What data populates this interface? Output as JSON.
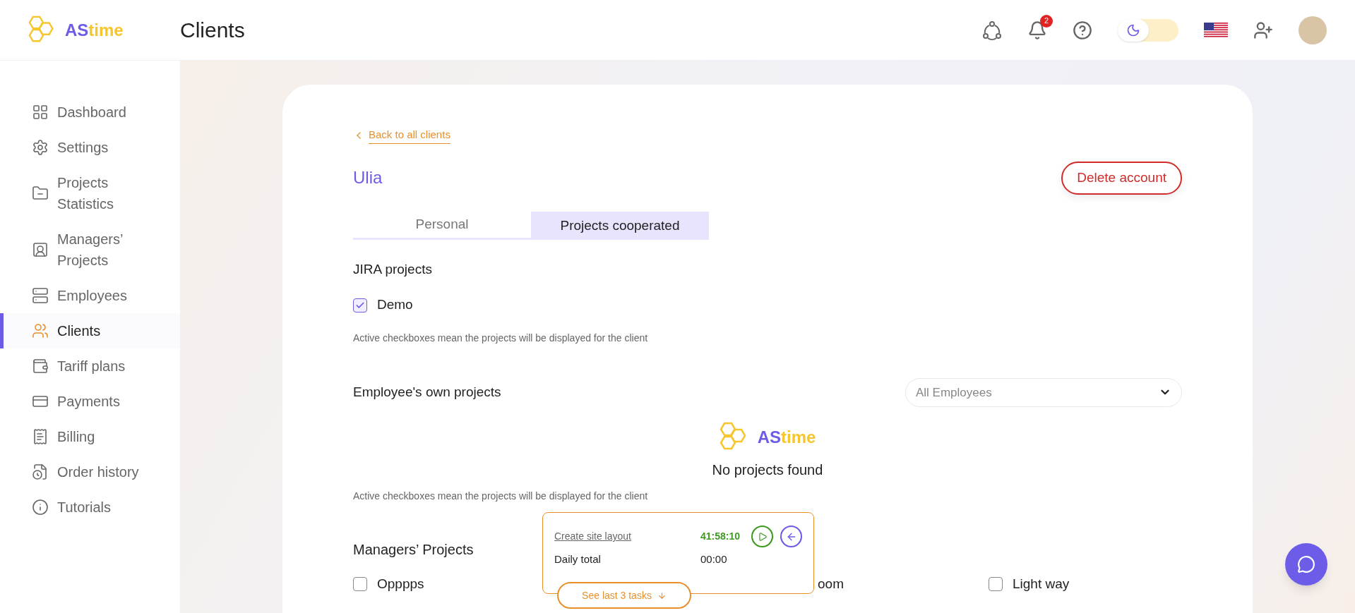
{
  "header": {
    "logo": {
      "prefix": "AS",
      "suffix": "time"
    },
    "title": "Clients",
    "notifications": "2",
    "dark_mode": false
  },
  "sidebar": {
    "items": [
      {
        "label": "Dashboard",
        "selected": false
      },
      {
        "label": "Settings",
        "selected": false
      },
      {
        "label": "Projects Statistics",
        "selected": false
      },
      {
        "label": "Managers’ Projects",
        "selected": false
      },
      {
        "label": "Employees",
        "selected": false
      },
      {
        "label": "Clients",
        "selected": true
      },
      {
        "label": "Tariff plans",
        "selected": false
      },
      {
        "label": "Payments",
        "selected": false
      },
      {
        "label": "Billing",
        "selected": false
      },
      {
        "label": "Order history",
        "selected": false
      },
      {
        "label": "Tutorials",
        "selected": false
      }
    ]
  },
  "client": {
    "back_link": "Back to all clients",
    "name": "Ulia",
    "delete_button": "Delete account",
    "tabs": [
      {
        "label": "Personal",
        "selected": false
      },
      {
        "label": "Projects cooperated",
        "selected": true
      }
    ],
    "jira": {
      "title": "JIRA projects",
      "projects": [
        {
          "label": "Demo",
          "checked": true
        }
      ],
      "hint": "Active checkboxes mean the projects will be displayed for the client"
    },
    "own": {
      "title": "Employee's own projects",
      "filter": "All Employees",
      "empty_logo": {
        "prefix": "AS",
        "suffix": "time"
      },
      "empty_text": "No projects found",
      "hint": "Active checkboxes mean the projects will be displayed for the client"
    },
    "managers": {
      "title": "Managers’ Projects",
      "projects": [
        {
          "label": "Opppps",
          "checked": false
        },
        {
          "label": "oom"
        },
        {
          "label": "Light way",
          "checked": false
        }
      ]
    }
  },
  "timer": {
    "task": "Create site layout",
    "task_time": "41:58:10",
    "daily_label": "Daily total",
    "daily_time": "00:00",
    "see_last": "See last 3 tasks"
  }
}
